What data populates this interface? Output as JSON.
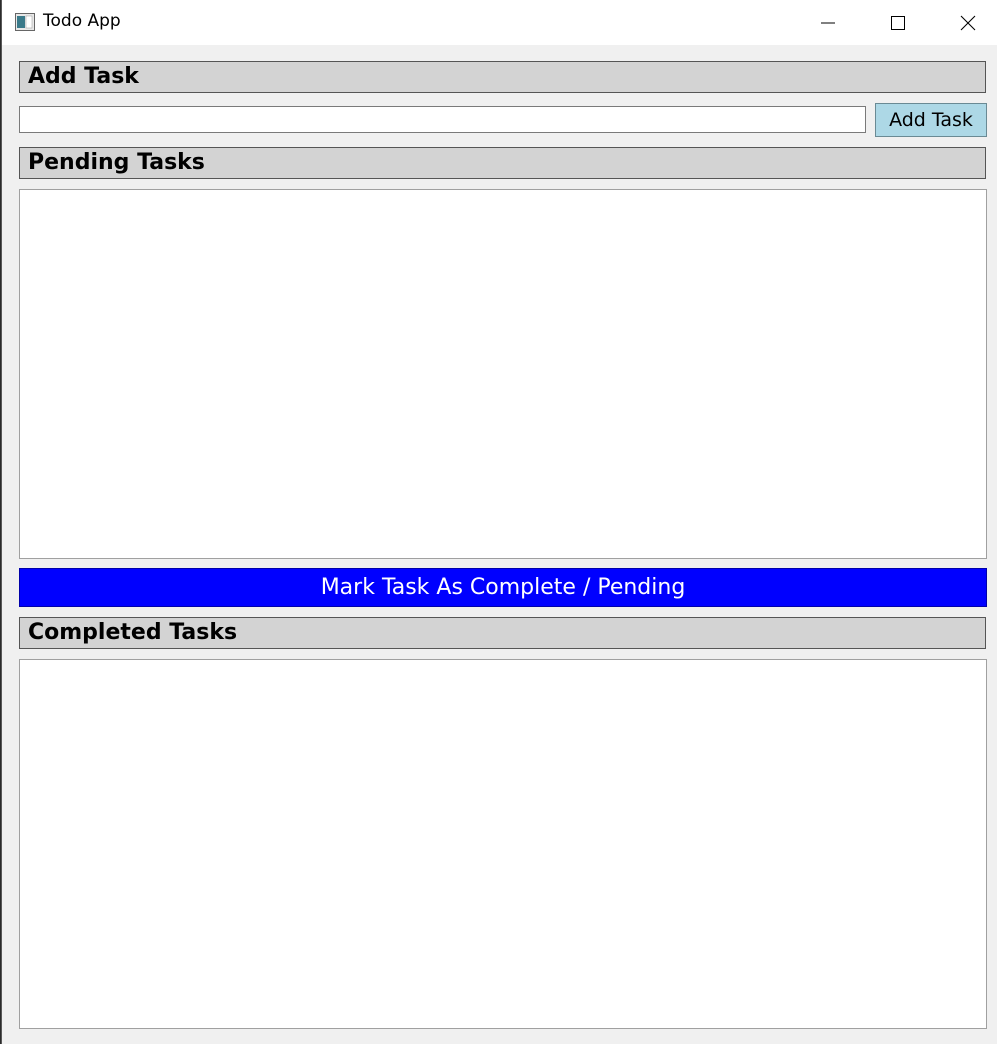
{
  "window": {
    "title": "Todo App"
  },
  "add_section": {
    "header": "Add Task",
    "input_value": "",
    "input_placeholder": "",
    "button_label": "Add Task"
  },
  "pending_section": {
    "header": "Pending Tasks",
    "items": []
  },
  "mark_button_label": "Mark Task As Complete / Pending",
  "completed_section": {
    "header": "Completed Tasks",
    "items": []
  },
  "colors": {
    "header_bg": "#d3d3d3",
    "add_button_bg": "#add8e6",
    "mark_button_bg": "#0000ff",
    "mark_button_text": "#ffffff"
  }
}
